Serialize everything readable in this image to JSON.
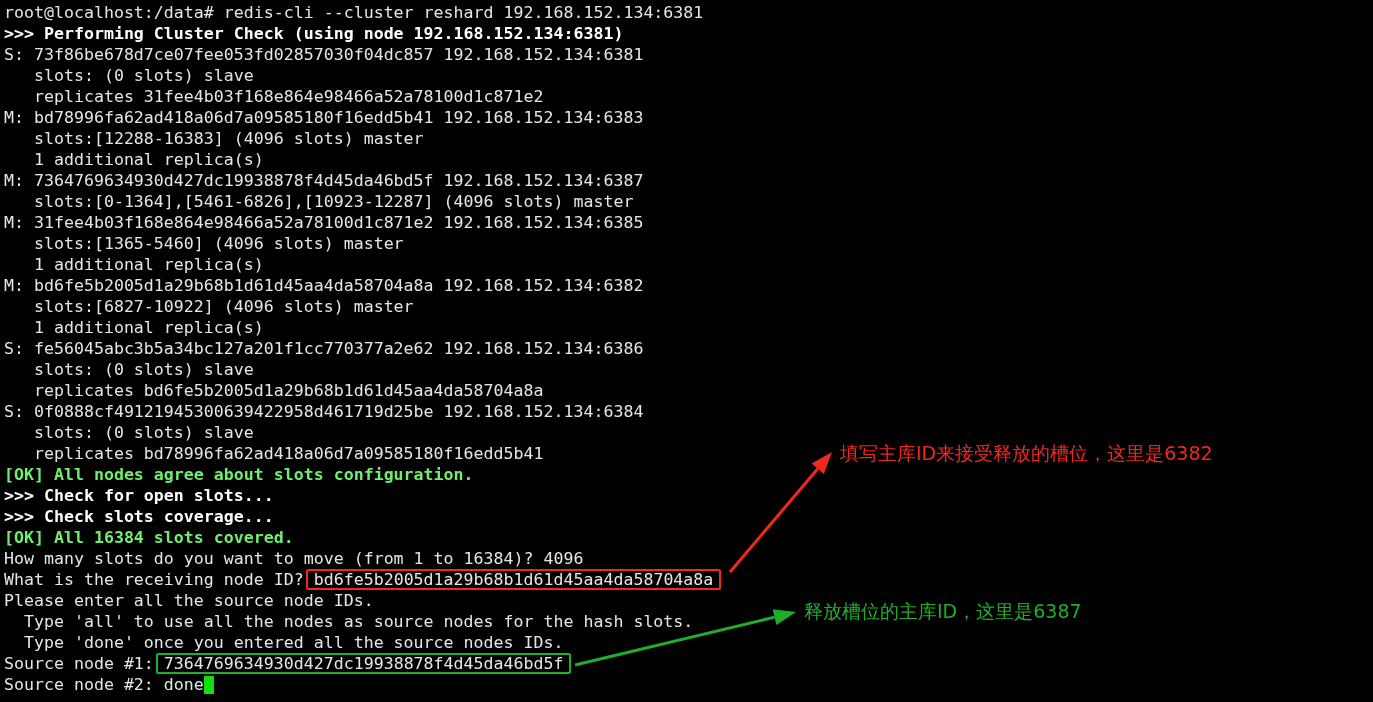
{
  "terminal": {
    "lines": [
      {
        "kind": "plain",
        "text": "root@localhost:/data# redis-cli --cluster reshard 192.168.152.134:6381"
      },
      {
        "kind": "bold",
        "text": ">>> Performing Cluster Check (using node 192.168.152.134:6381)"
      },
      {
        "kind": "plain",
        "text": "S: 73f86be678d7ce07fee053fd02857030f04dc857 192.168.152.134:6381"
      },
      {
        "kind": "plain",
        "text": "   slots: (0 slots) slave"
      },
      {
        "kind": "plain",
        "text": "   replicates 31fee4b03f168e864e98466a52a78100d1c871e2"
      },
      {
        "kind": "plain",
        "text": "M: bd78996fa62ad418a06d7a09585180f16edd5b41 192.168.152.134:6383"
      },
      {
        "kind": "plain",
        "text": "   slots:[12288-16383] (4096 slots) master"
      },
      {
        "kind": "plain",
        "text": "   1 additional replica(s)"
      },
      {
        "kind": "plain",
        "text": "M: 7364769634930d427dc19938878f4d45da46bd5f 192.168.152.134:6387"
      },
      {
        "kind": "plain",
        "text": "   slots:[0-1364],[5461-6826],[10923-12287] (4096 slots) master"
      },
      {
        "kind": "plain",
        "text": "M: 31fee4b03f168e864e98466a52a78100d1c871e2 192.168.152.134:6385"
      },
      {
        "kind": "plain",
        "text": "   slots:[1365-5460] (4096 slots) master"
      },
      {
        "kind": "plain",
        "text": "   1 additional replica(s)"
      },
      {
        "kind": "plain",
        "text": "M: bd6fe5b2005d1a29b68b1d61d45aa4da58704a8a 192.168.152.134:6382"
      },
      {
        "kind": "plain",
        "text": "   slots:[6827-10922] (4096 slots) master"
      },
      {
        "kind": "plain",
        "text": "   1 additional replica(s)"
      },
      {
        "kind": "plain",
        "text": "S: fe56045abc3b5a34bc127a201f1cc770377a2e62 192.168.152.134:6386"
      },
      {
        "kind": "plain",
        "text": "   slots: (0 slots) slave"
      },
      {
        "kind": "plain",
        "text": "   replicates bd6fe5b2005d1a29b68b1d61d45aa4da58704a8a"
      },
      {
        "kind": "plain",
        "text": "S: 0f0888cf49121945300639422958d461719d25be 192.168.152.134:6384"
      },
      {
        "kind": "plain",
        "text": "   slots: (0 slots) slave"
      },
      {
        "kind": "plain",
        "text": "   replicates bd78996fa62ad418a06d7a09585180f16edd5b41"
      },
      {
        "kind": "ok",
        "text": "[OK] All nodes agree about slots configuration."
      },
      {
        "kind": "bold",
        "text": ">>> Check for open slots..."
      },
      {
        "kind": "bold",
        "text": ">>> Check slots coverage..."
      },
      {
        "kind": "ok",
        "text": "[OK] All 16384 slots covered."
      },
      {
        "kind": "plain",
        "text": "How many slots do you want to move (from 1 to 16384)? 4096"
      },
      {
        "kind": "boxed",
        "text": "What is the receiving node ID?",
        "value": "bd6fe5b2005d1a29b68b1d61d45aa4da58704a8a",
        "color": "#f0281e"
      },
      {
        "kind": "plain",
        "text": "Please enter all the source node IDs."
      },
      {
        "kind": "plain",
        "text": "  Type 'all' to use all the nodes as source nodes for the hash slots."
      },
      {
        "kind": "plain",
        "text": "  Type 'done' once you entered all the source nodes IDs."
      },
      {
        "kind": "boxed",
        "text": "Source node #1:",
        "value": "7364769634930d427dc19938878f4d45da46bd5f",
        "color": "#1fae2a"
      },
      {
        "kind": "input",
        "text": "Source node #2: done",
        "cursor": true
      }
    ]
  },
  "annotations": [
    {
      "text": "填写主库ID来接受释放的槽位，这里是6382",
      "color": "#f0281e"
    },
    {
      "text": "释放槽位的主库ID，这里是6387",
      "color": "#1fae2a"
    }
  ]
}
